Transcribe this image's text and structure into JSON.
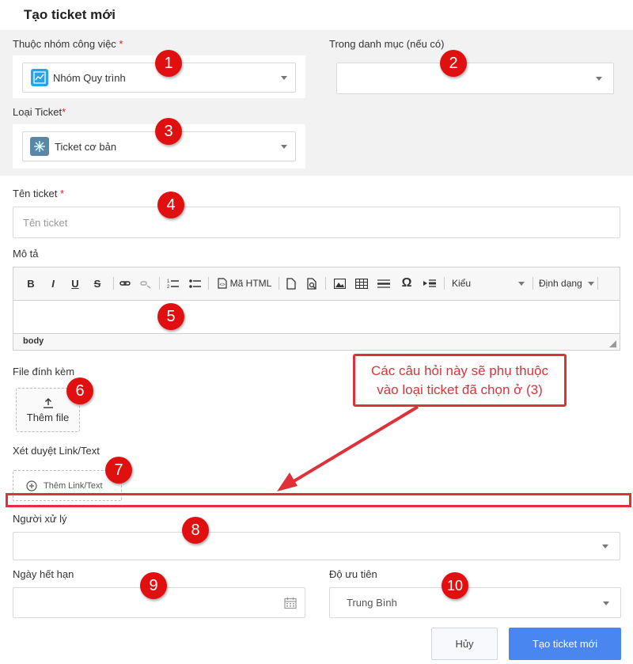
{
  "header": {
    "title": "Tạo ticket mới"
  },
  "work_group": {
    "label": "Thuộc nhóm công việc",
    "required_mark": "*",
    "value": "Nhóm Quy trình",
    "icon": "chart-line-icon"
  },
  "category": {
    "label": "Trong danh mục (nếu có)",
    "value": ""
  },
  "ticket_type": {
    "label": "Loại Ticket",
    "required_mark": "*",
    "value": "Ticket cơ bản",
    "icon": "snowflake-icon"
  },
  "ticket_name": {
    "label": "Tên ticket",
    "required_mark": "*",
    "placeholder": "Tên ticket"
  },
  "description": {
    "label": "Mô tả",
    "toolbar": {
      "bold": "B",
      "italic": "I",
      "underline": "U",
      "strike": "S",
      "html_label": "Mã HTML",
      "style_label": "Kiểu",
      "format_label": "Định dạng",
      "omega": "Ω"
    },
    "status_path": "body"
  },
  "attachment": {
    "label": "File đính kèm",
    "button_label": "Thêm file"
  },
  "approval": {
    "label": "Xét duyệt Link/Text",
    "button_label": "Thêm Link/Text"
  },
  "assignee": {
    "label": "Người xử lý",
    "value": ""
  },
  "due_date": {
    "label": "Ngày hết hạn",
    "value": ""
  },
  "priority": {
    "label": "Độ ưu tiên",
    "value": "Trung Bình"
  },
  "actions": {
    "cancel_label": "Hủy",
    "submit_label": "Tạo ticket mới"
  },
  "annotations": {
    "badges": [
      "1",
      "2",
      "3",
      "4",
      "5",
      "6",
      "7",
      "8",
      "9",
      "10"
    ],
    "callout_line1": "Các câu hỏi này sẽ phụ thuộc",
    "callout_line2": "vào loại ticket đã chọn ở (3)",
    "accent_color": "#e0313b"
  },
  "colors": {
    "primary": "#4a86f0",
    "badge": "#e01010",
    "icon_blue": "#29a3e8"
  }
}
